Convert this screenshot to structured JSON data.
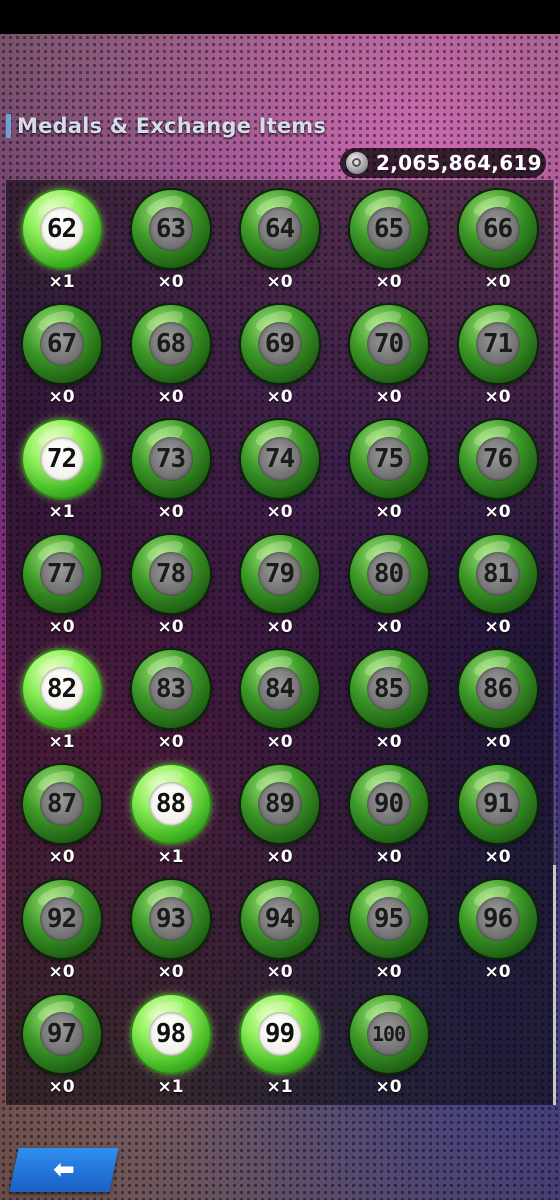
{
  "header": {
    "title": "Medals & Exchange Items"
  },
  "currency": {
    "icon": "coin-icon",
    "value": "2,065,864,619"
  },
  "medals": [
    {
      "number": "62",
      "count": "×1",
      "owned": true
    },
    {
      "number": "63",
      "count": "×0",
      "owned": false
    },
    {
      "number": "64",
      "count": "×0",
      "owned": false
    },
    {
      "number": "65",
      "count": "×0",
      "owned": false
    },
    {
      "number": "66",
      "count": "×0",
      "owned": false
    },
    {
      "number": "67",
      "count": "×0",
      "owned": false
    },
    {
      "number": "68",
      "count": "×0",
      "owned": false
    },
    {
      "number": "69",
      "count": "×0",
      "owned": false
    },
    {
      "number": "70",
      "count": "×0",
      "owned": false
    },
    {
      "number": "71",
      "count": "×0",
      "owned": false
    },
    {
      "number": "72",
      "count": "×1",
      "owned": true
    },
    {
      "number": "73",
      "count": "×0",
      "owned": false
    },
    {
      "number": "74",
      "count": "×0",
      "owned": false
    },
    {
      "number": "75",
      "count": "×0",
      "owned": false
    },
    {
      "number": "76",
      "count": "×0",
      "owned": false
    },
    {
      "number": "77",
      "count": "×0",
      "owned": false
    },
    {
      "number": "78",
      "count": "×0",
      "owned": false
    },
    {
      "number": "79",
      "count": "×0",
      "owned": false
    },
    {
      "number": "80",
      "count": "×0",
      "owned": false
    },
    {
      "number": "81",
      "count": "×0",
      "owned": false
    },
    {
      "number": "82",
      "count": "×1",
      "owned": true
    },
    {
      "number": "83",
      "count": "×0",
      "owned": false
    },
    {
      "number": "84",
      "count": "×0",
      "owned": false
    },
    {
      "number": "85",
      "count": "×0",
      "owned": false
    },
    {
      "number": "86",
      "count": "×0",
      "owned": false
    },
    {
      "number": "87",
      "count": "×0",
      "owned": false
    },
    {
      "number": "88",
      "count": "×1",
      "owned": true
    },
    {
      "number": "89",
      "count": "×0",
      "owned": false
    },
    {
      "number": "90",
      "count": "×0",
      "owned": false
    },
    {
      "number": "91",
      "count": "×0",
      "owned": false
    },
    {
      "number": "92",
      "count": "×0",
      "owned": false
    },
    {
      "number": "93",
      "count": "×0",
      "owned": false
    },
    {
      "number": "94",
      "count": "×0",
      "owned": false
    },
    {
      "number": "95",
      "count": "×0",
      "owned": false
    },
    {
      "number": "96",
      "count": "×0",
      "owned": false
    },
    {
      "number": "97",
      "count": "×0",
      "owned": false
    },
    {
      "number": "98",
      "count": "×1",
      "owned": true
    },
    {
      "number": "99",
      "count": "×1",
      "owned": true
    },
    {
      "number": "100",
      "count": "×0",
      "owned": false
    }
  ],
  "footer": {
    "back_icon": "back-arrow-icon"
  },
  "colors": {
    "medal_green": "#3d9a28",
    "medal_owned": "#8ff05a",
    "back_button": "#2f8ff0"
  }
}
